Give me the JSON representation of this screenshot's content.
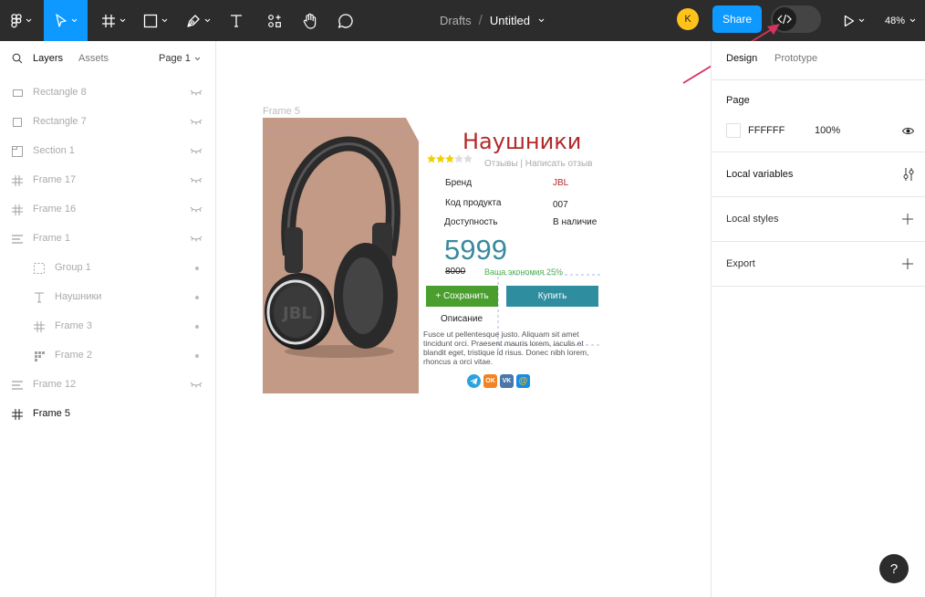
{
  "toolbar": {
    "breadcrumb_drafts": "Drafts",
    "breadcrumb_file": "Untitled",
    "avatar_letter": "K",
    "share_label": "Share",
    "zoom": "48%"
  },
  "left_panel": {
    "tab_layers": "Layers",
    "tab_assets": "Assets",
    "page_selector": "Page 1",
    "layers": [
      {
        "name": "Rectangle 8",
        "icon": "rectangle-icon"
      },
      {
        "name": "Rectangle 7",
        "icon": "rectangle-icon"
      },
      {
        "name": "Section 1",
        "icon": "section-icon"
      },
      {
        "name": "Frame 17",
        "icon": "frame-icon"
      },
      {
        "name": "Frame 16",
        "icon": "frame-icon"
      },
      {
        "name": "Frame 1",
        "icon": "auto-layout-icon"
      },
      {
        "name": "Group 1",
        "icon": "group-icon"
      },
      {
        "name": "Наушники",
        "icon": "text-icon"
      },
      {
        "name": "Frame 3",
        "icon": "frame-icon"
      },
      {
        "name": "Frame 2",
        "icon": "grid-icon"
      },
      {
        "name": "Frame 12",
        "icon": "auto-layout-icon"
      },
      {
        "name": "Frame 5",
        "icon": "frame-icon"
      }
    ]
  },
  "canvas": {
    "frame_label": "Frame 5",
    "product": {
      "title": "Наушники",
      "reviews": "Отзывы | Написать отзыв",
      "brand_label": "Бренд",
      "brand_value": "JBL",
      "code_label": "Код продукта",
      "code_value": "007",
      "availability_label": "Доступность",
      "availability_value": "В наличие",
      "price": "5999",
      "old_price": "8000",
      "savings": "Ваша экономия 25%",
      "save_button": "+ Сохранить",
      "buy_button": "Купить",
      "description_title": "Описание",
      "description": "Fusce ut pellentesque justo. Aliquam sit amet tincidunt orci. Praesent mauris lorem, iaculis et blandit eget, tristique id risus. Donec nibh lorem, rhoncus a orci vitae.",
      "rating": 3,
      "rating_max": 5,
      "social_ok": "OK",
      "social_vk": "VK",
      "social_mail": "@",
      "headphone_logo": "JBL"
    }
  },
  "right_panel": {
    "tab_design": "Design",
    "tab_prototype": "Prototype",
    "page_section": "Page",
    "page_color": "FFFFFF",
    "page_opacity": "100%",
    "local_variables": "Local variables",
    "local_styles": "Local styles",
    "export": "Export"
  },
  "help_label": "?",
  "colors": {
    "accent": "#0d99ff",
    "toolbar_bg": "#2c2c2c",
    "product_title": "#b22a2a",
    "price": "#3a8a9e",
    "save_button": "#4a9e2e",
    "buy_button": "#2f8da0",
    "annotation_arrow": "#d6335f"
  }
}
